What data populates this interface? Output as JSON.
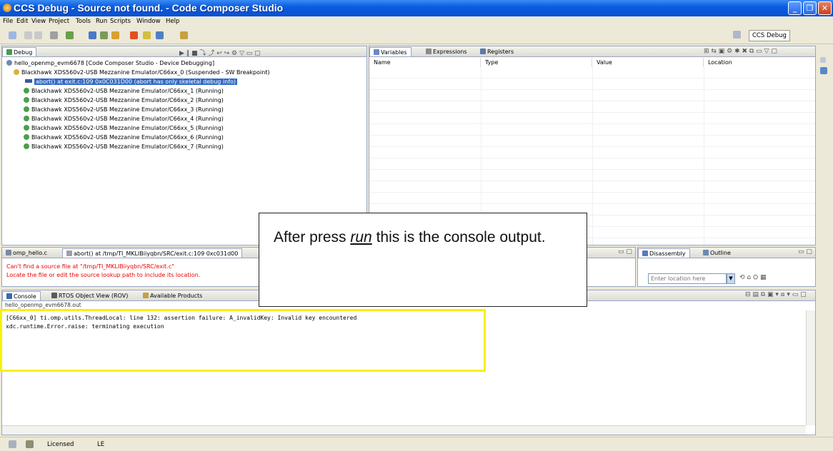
{
  "window": {
    "title": "CCS Debug - Source not found. - Code Composer Studio"
  },
  "menu": [
    "File",
    "Edit",
    "View",
    "Project",
    "Tools",
    "Run",
    "Scripts",
    "Window",
    "Help"
  ],
  "perspective": {
    "label": "CCS Debug"
  },
  "debug_view": {
    "tab": "Debug",
    "items": [
      {
        "label": "hello_openmp_evm6678 [Code Composer Studio - Device Debugging]"
      },
      {
        "label": "Blackhawk XDS560v2-USB Mezzanine Emulator/C66xx_0 (Suspended - SW Breakpoint)"
      },
      {
        "label": "abort() at exit.c:109 0x0C031D00  (abort has only skeletal debug info)"
      },
      {
        "label": "Blackhawk XDS560v2-USB Mezzanine Emulator/C66xx_1 (Running)"
      },
      {
        "label": "Blackhawk XDS560v2-USB Mezzanine Emulator/C66xx_2 (Running)"
      },
      {
        "label": "Blackhawk XDS560v2-USB Mezzanine Emulator/C66xx_3 (Running)"
      },
      {
        "label": "Blackhawk XDS560v2-USB Mezzanine Emulator/C66xx_4 (Running)"
      },
      {
        "label": "Blackhawk XDS560v2-USB Mezzanine Emulator/C66xx_5 (Running)"
      },
      {
        "label": "Blackhawk XDS560v2-USB Mezzanine Emulator/C66xx_6 (Running)"
      },
      {
        "label": "Blackhawk XDS560v2-USB Mezzanine Emulator/C66xx_7 (Running)"
      }
    ]
  },
  "variables_view": {
    "tabs": [
      "Variables",
      "Expressions",
      "Registers"
    ],
    "columns": [
      "Name",
      "Type",
      "Value",
      "Location"
    ]
  },
  "editor": {
    "tabs": [
      "omp_hello.c",
      "abort() at /tmp/TI_MKLIBiiyqbn/SRC/exit.c:109 0xc031d00"
    ],
    "error_line1": "Can't find a source file at \"/tmp/TI_MKLIBiiyqbn/SRC/exit.c\"",
    "error_line2": "Locate the file or edit the source lookup path to include its location."
  },
  "disassembly": {
    "tabs": [
      "Disassembly",
      "Outline"
    ],
    "location_placeholder": "Enter location here"
  },
  "console": {
    "tabs": [
      "Console",
      "RTOS Object View (ROV)",
      "Available Products"
    ],
    "header": "hello_openmp_evm6678.out",
    "lines": [
      "[C66xx_0] ti.omp.utils.ThreadLocal: line 132: assertion failure: A_invalidKey: Invalid key encountered",
      "xdc.runtime.Error.raise: terminating execution"
    ]
  },
  "callout": {
    "before": "After press ",
    "emph": "run",
    "after": " this is the console output."
  },
  "status": {
    "license": "Licensed",
    "mode": "LE"
  },
  "colors": {
    "highlight": "#f7f200",
    "selection": "#316ac5",
    "error": "#e00000"
  }
}
